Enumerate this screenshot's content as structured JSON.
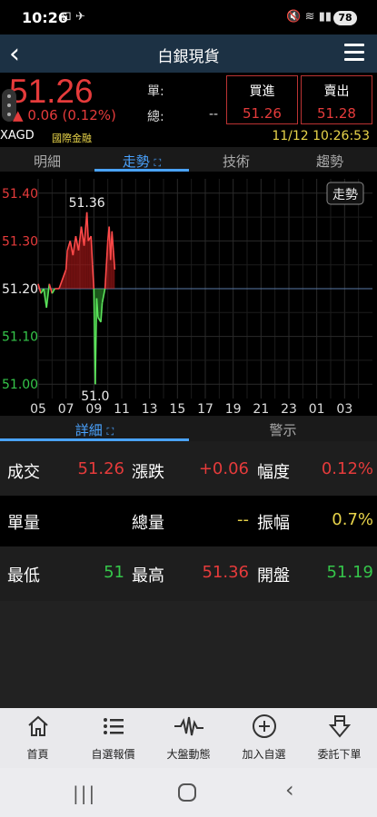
{
  "status": {
    "time": "10:26",
    "battery": "78"
  },
  "header": {
    "title": "白銀現貨"
  },
  "quote": {
    "price": "51.26",
    "change": "0.06 (0.12%)",
    "change_arrow": "▲",
    "single_label": "單:",
    "total_label": "總:",
    "total_value": "--",
    "buy_label": "買進",
    "buy_price": "51.26",
    "sell_label": "賣出",
    "sell_price": "51.28",
    "symbol": "XAGD",
    "market": "國際金融",
    "datetime": "11/12 10:26:53"
  },
  "tabs": [
    "明細",
    "走勢",
    "技術",
    "趨勢"
  ],
  "chart_data": {
    "type": "line",
    "badge": "走勢",
    "x_ticks": [
      "05",
      "07",
      "09",
      "11",
      "13",
      "15",
      "17",
      "19",
      "21",
      "23",
      "01",
      "03"
    ],
    "y_ticks": [
      "51.40",
      "51.30",
      "51.20",
      "51.10",
      "51.00"
    ],
    "ylim": [
      50.97,
      51.43
    ],
    "reference": 51.2,
    "high_label": "51.36",
    "low_label": "51.0",
    "x": [
      5.0,
      5.2,
      5.4,
      5.6,
      5.8,
      6.0,
      6.2,
      6.5,
      7.0,
      7.1,
      7.3,
      7.5,
      7.7,
      7.9,
      8.1,
      8.3,
      8.5,
      8.6,
      8.8,
      8.9,
      9.0,
      9.05,
      9.1,
      9.2,
      9.3,
      9.5,
      9.6,
      9.8,
      10.0,
      10.1,
      10.2,
      10.3,
      10.4,
      10.5
    ],
    "y": [
      51.21,
      51.19,
      51.2,
      51.16,
      51.21,
      51.19,
      51.2,
      51.2,
      51.24,
      51.28,
      51.3,
      51.27,
      51.31,
      51.28,
      51.33,
      51.29,
      51.36,
      51.3,
      51.31,
      51.25,
      51.2,
      51.1,
      51.0,
      51.18,
      51.14,
      51.13,
      51.17,
      51.2,
      51.3,
      51.33,
      51.26,
      51.32,
      51.28,
      51.24
    ]
  },
  "subtabs": [
    "詳細",
    "警示"
  ],
  "details": {
    "r1": {
      "l1": "成交",
      "v1": "51.26",
      "l2": "漲跌",
      "v2": "+0.06",
      "l3": "幅度",
      "v3": "0.12%"
    },
    "r2": {
      "l1": "單量",
      "v1": "",
      "l2": "總量",
      "v2": "--",
      "l3": "振幅",
      "v3": "0.7%"
    },
    "r3": {
      "l1": "最低",
      "v1": "51",
      "l2": "最高",
      "v2": "51.36",
      "l3": "開盤",
      "v3": "51.19"
    }
  },
  "nav": [
    "首頁",
    "自選報價",
    "大盤動態",
    "加入自選",
    "委託下單"
  ]
}
